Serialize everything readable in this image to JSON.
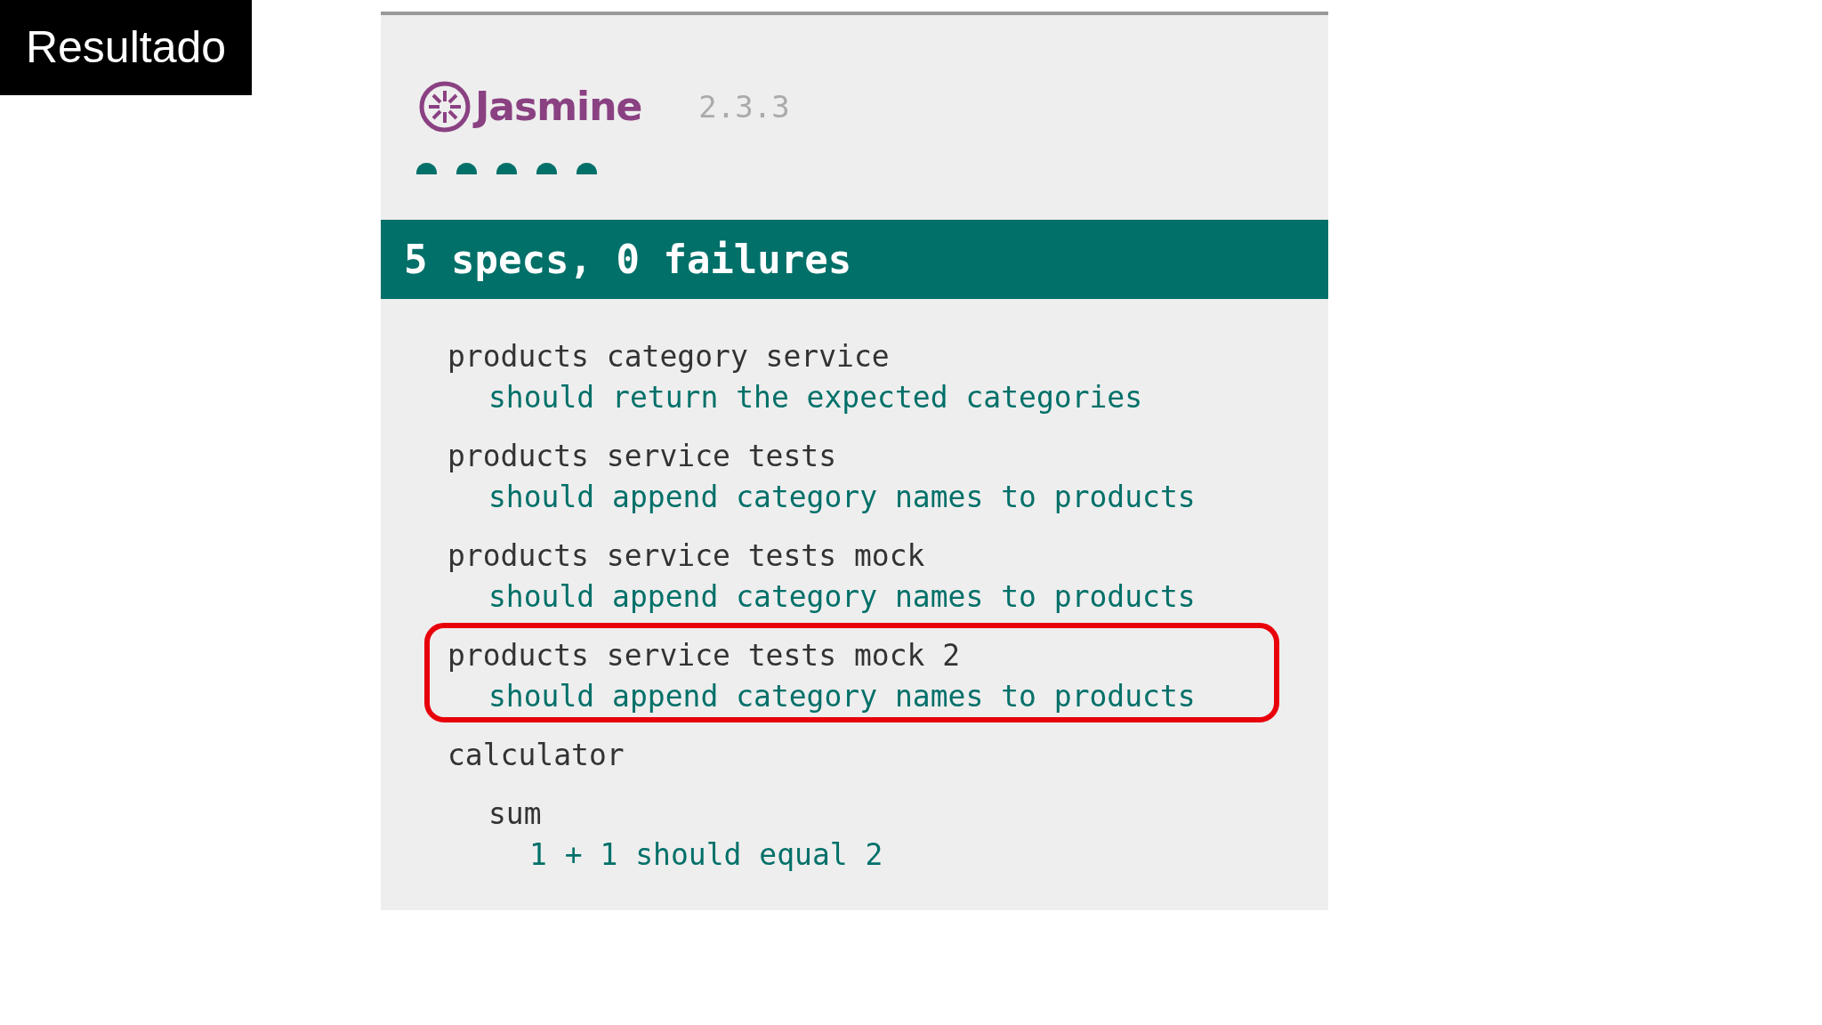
{
  "slide_label": "Resultado",
  "jasmine": {
    "logo_text": "Jasmine",
    "version": "2.3.3",
    "dots": [
      {
        "passed": true
      },
      {
        "passed": true
      },
      {
        "passed": true
      },
      {
        "passed": true
      },
      {
        "passed": true
      }
    ],
    "summary": {
      "text": "5 specs, 0 failures",
      "passed": true
    },
    "results": [
      {
        "kind": "suite",
        "name": "products category service",
        "highlighted": false,
        "children": [
          {
            "kind": "spec",
            "name": "should return the expected categories",
            "passed": true
          }
        ]
      },
      {
        "kind": "suite",
        "name": "products service tests",
        "highlighted": false,
        "children": [
          {
            "kind": "spec",
            "name": "should append category names to products",
            "passed": true
          }
        ]
      },
      {
        "kind": "suite",
        "name": "products service tests mock",
        "highlighted": false,
        "children": [
          {
            "kind": "spec",
            "name": "should append category names to products",
            "passed": true
          }
        ]
      },
      {
        "kind": "suite",
        "name": "products service tests mock 2",
        "highlighted": true,
        "children": [
          {
            "kind": "spec",
            "name": "should append category names to products",
            "passed": true
          }
        ]
      },
      {
        "kind": "suite",
        "name": "calculator",
        "highlighted": false,
        "children": [
          {
            "kind": "suite",
            "name": "sum",
            "highlighted": false,
            "children": [
              {
                "kind": "spec",
                "name": "1 + 1 should equal 2",
                "passed": true
              }
            ]
          }
        ]
      }
    ]
  }
}
